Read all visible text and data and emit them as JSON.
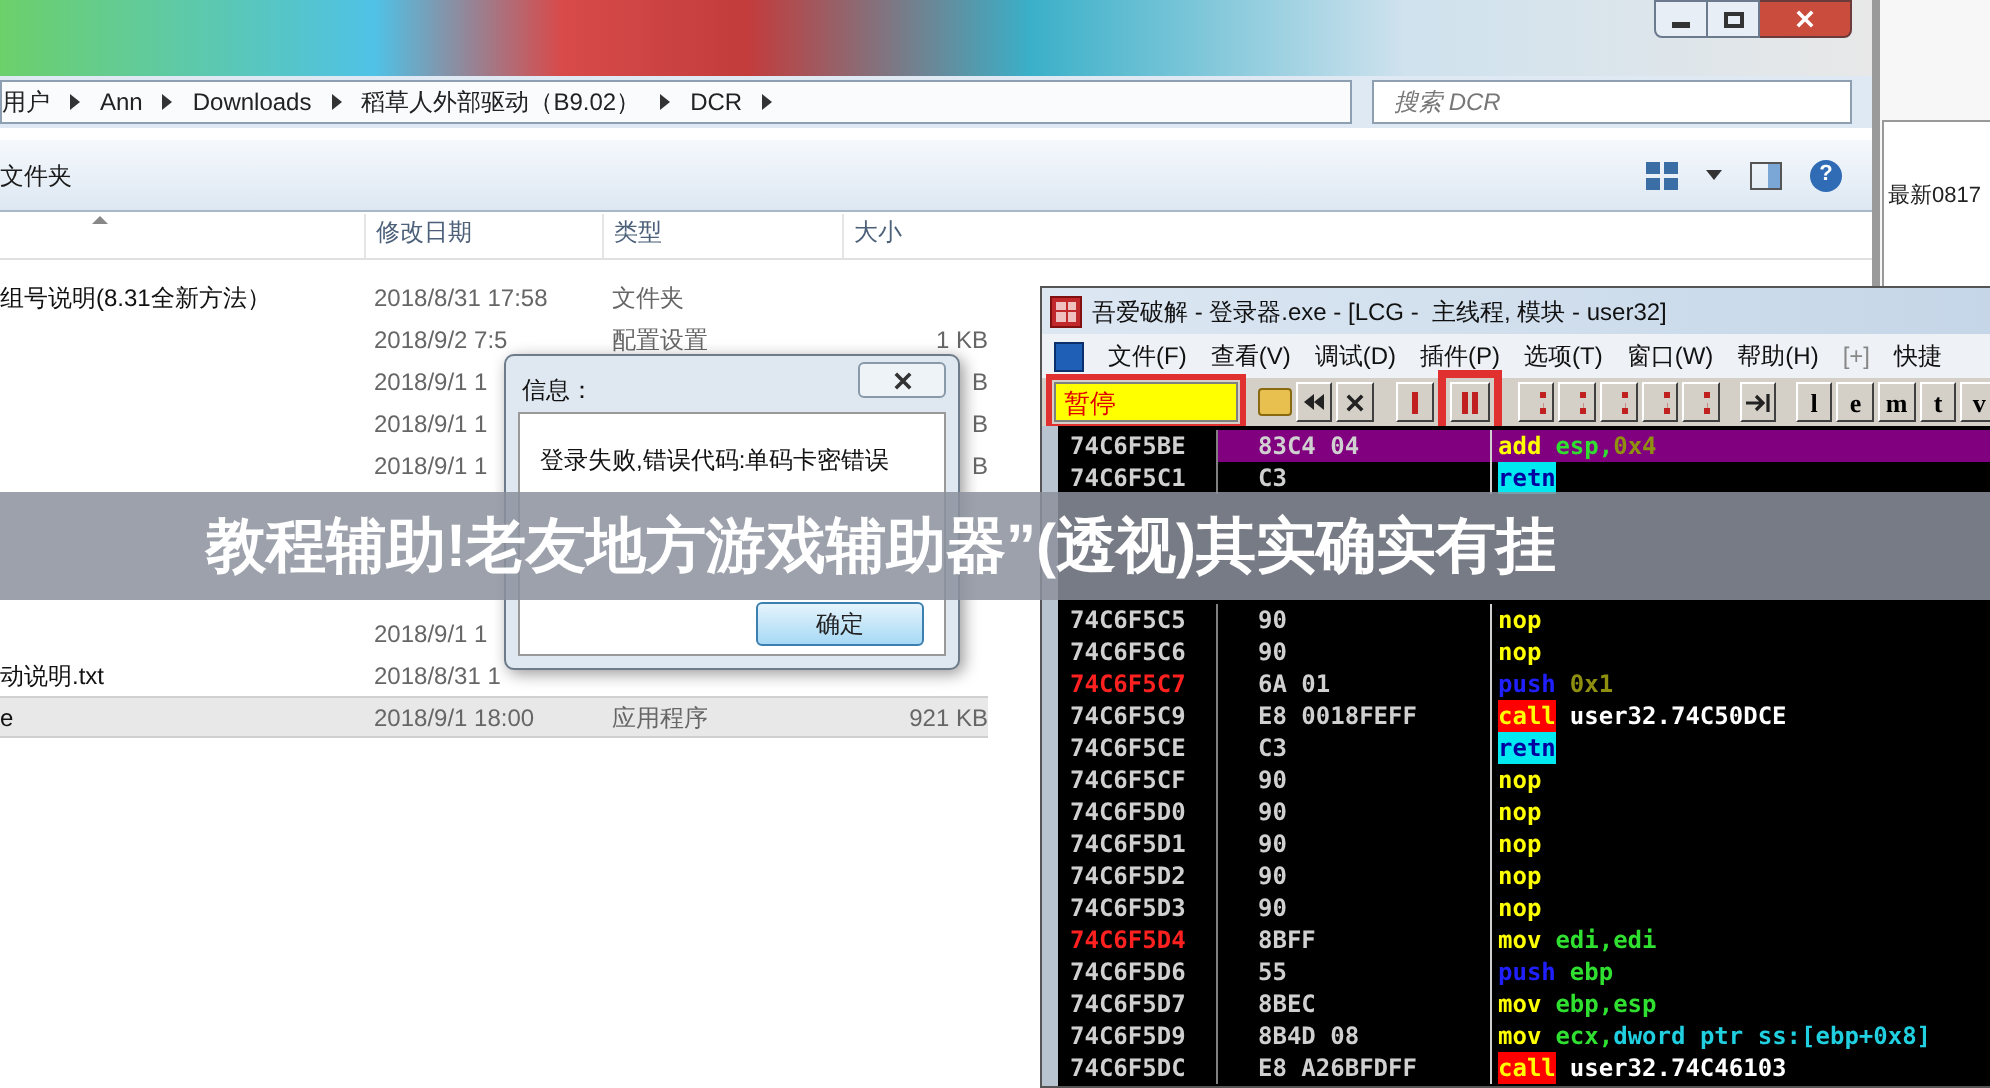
{
  "back_window": {
    "text": "最新0817"
  },
  "explorer": {
    "breadcrumb": [
      "用户",
      "Ann",
      "Downloads",
      "稻草人外部驱动（B9.02）",
      "DCR"
    ],
    "search": {
      "placeholder": "搜索 DCR"
    },
    "toolbar_label": "文件夹",
    "help_glyph": "?",
    "columns": [
      "修改日期",
      "类型",
      "大小"
    ],
    "rows_above": [
      {
        "name": "组号说明(8.31全新方法）",
        "date": "2018/8/31 17:58",
        "type": "文件夹",
        "selected": false
      },
      {
        "date": "2018/9/2 7:5",
        "type": "配置设置",
        "size": "1 KB",
        "selected": false
      },
      {
        "date": "2018/9/1 1",
        "size": "B",
        "selected": false
      },
      {
        "date": "2018/9/1 1",
        "size": "B",
        "selected": false
      },
      {
        "date": "2018/9/1 1",
        "size": "B",
        "selected": false
      }
    ],
    "rows_below": [
      {
        "date": "2018/9/1 1",
        "selected": false
      },
      {
        "name": "动说明.txt",
        "date": "2018/8/31 1",
        "selected": false
      },
      {
        "name": "e",
        "date": "2018/9/1 18:00",
        "type": "应用程序",
        "size": "921 KB",
        "selected": true
      }
    ]
  },
  "dialog": {
    "title": "信息：",
    "message": "登录失败,错误代码:单码卡密错误",
    "button": "确定"
  },
  "debugger": {
    "title": "吾爱破解 - 登录器.exe - [LCG -  主线程, 模块 - user32]",
    "menu": [
      "文件(F)",
      "查看(V)",
      "调试(D)",
      "插件(P)",
      "选项(T)",
      "窗口(W)",
      "帮助(H)",
      "[+]",
      "快捷"
    ],
    "status": "暂停",
    "letter_buttons": [
      "l",
      "e",
      "m",
      "t",
      "v"
    ],
    "lines_above": [
      {
        "address": "74C6F5BE",
        "hex": "83C4 04",
        "mnemonic": "add",
        "kind": "plain",
        "operands": [
          {
            "text": "esp,",
            "kind": "reg"
          },
          {
            "text": "0x4",
            "kind": "const"
          }
        ],
        "marked": false,
        "selected": true
      },
      {
        "address": "74C6F5C1",
        "hex": "C3",
        "mnemonic": "retn",
        "kind": "ret",
        "marked": false,
        "selected": false
      }
    ],
    "lines_below": [
      {
        "address": "74C6F5C5",
        "hex": "90",
        "mnemonic": "nop",
        "kind": "plain",
        "marked": false,
        "selected": false
      },
      {
        "address": "74C6F5C6",
        "hex": "90",
        "mnemonic": "nop",
        "kind": "plain",
        "marked": false,
        "selected": false
      },
      {
        "address": "74C6F5C7",
        "hex": "6A 01",
        "mnemonic": "push",
        "kind": "push",
        "operands": [
          {
            "text": "0x1",
            "kind": "const"
          }
        ],
        "marked": true,
        "selected": false
      },
      {
        "address": "74C6F5C9",
        "hex": "E8 0018FEFF",
        "mnemonic": "call",
        "kind": "call",
        "operands": [
          {
            "text": "user32.74C50DCE",
            "kind": "label"
          }
        ],
        "marked": false,
        "selected": false
      },
      {
        "address": "74C6F5CE",
        "hex": "C3",
        "mnemonic": "retn",
        "kind": "ret",
        "marked": false,
        "selected": false
      },
      {
        "address": "74C6F5CF",
        "hex": "90",
        "mnemonic": "nop",
        "kind": "plain",
        "marked": false,
        "selected": false
      },
      {
        "address": "74C6F5D0",
        "hex": "90",
        "mnemonic": "nop",
        "kind": "plain",
        "marked": false,
        "selected": false
      },
      {
        "address": "74C6F5D1",
        "hex": "90",
        "mnemonic": "nop",
        "kind": "plain",
        "marked": false,
        "selected": false
      },
      {
        "address": "74C6F5D2",
        "hex": "90",
        "mnemonic": "nop",
        "kind": "plain",
        "marked": false,
        "selected": false
      },
      {
        "address": "74C6F5D3",
        "hex": "90",
        "mnemonic": "nop",
        "kind": "plain",
        "marked": false,
        "selected": false
      },
      {
        "address": "74C6F5D4",
        "hex": "8BFF",
        "mnemonic": "mov",
        "kind": "plain",
        "operands": [
          {
            "text": "edi,edi",
            "kind": "reg"
          }
        ],
        "marked": true,
        "selected": false
      },
      {
        "address": "74C6F5D6",
        "hex": "55",
        "mnemonic": "push",
        "kind": "push",
        "operands": [
          {
            "text": "ebp",
            "kind": "reg"
          }
        ],
        "marked": false,
        "selected": false
      },
      {
        "address": "74C6F5D7",
        "hex": "8BEC",
        "mnemonic": "mov",
        "kind": "plain",
        "operands": [
          {
            "text": "ebp,esp",
            "kind": "reg"
          }
        ],
        "marked": false,
        "selected": false
      },
      {
        "address": "74C6F5D9",
        "hex": "8B4D 08",
        "mnemonic": "mov",
        "kind": "plain",
        "operands": [
          {
            "text": "ecx,",
            "kind": "reg"
          },
          {
            "text": "dword ptr ss:[ebp+0x8]",
            "kind": "mem"
          }
        ],
        "marked": false,
        "selected": false
      },
      {
        "address": "74C6F5DC",
        "hex": "E8 A26BFDFF",
        "mnemonic": "call",
        "kind": "call",
        "operands": [
          {
            "text": "user32.74C46103",
            "kind": "label"
          }
        ],
        "marked": false,
        "selected": false
      }
    ]
  },
  "banner": "教程辅助!老友地方游戏辅助器”(透视)其实确实有挂"
}
